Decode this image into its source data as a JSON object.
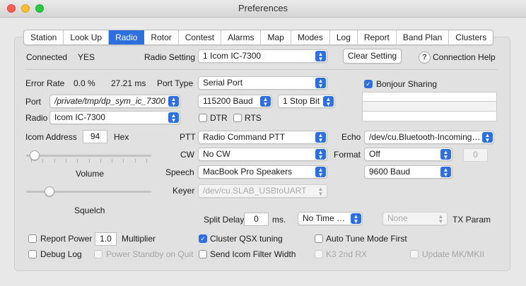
{
  "window": {
    "title": "Preferences"
  },
  "tabs": [
    {
      "label": "Station",
      "active": false
    },
    {
      "label": "Look Up",
      "active": false
    },
    {
      "label": "Radio",
      "active": true
    },
    {
      "label": "Rotor",
      "active": false
    },
    {
      "label": "Contest",
      "active": false
    },
    {
      "label": "Alarms",
      "active": false
    },
    {
      "label": "Map",
      "active": false
    },
    {
      "label": "Modes",
      "active": false
    },
    {
      "label": "Log",
      "active": false
    },
    {
      "label": "Report",
      "active": false
    },
    {
      "label": "Band Plan",
      "active": false
    },
    {
      "label": "Clusters",
      "active": false
    }
  ],
  "connection": {
    "status_label": "Connected",
    "status_value": "YES",
    "radio_setting_label": "Radio Setting",
    "radio_setting_value": "1 Icom IC-7300",
    "clear_setting_label": "Clear Setting",
    "help_label": "Connection Help"
  },
  "serial": {
    "error_rate_label": "Error Rate",
    "error_rate_value": "0.0 %",
    "latency_value": "27.21 ms",
    "port_type_label": "Port Type",
    "port_type_value": "Serial Port",
    "port_label": "Port",
    "port_value": "/private/tmp/dp_sym_ic_7300",
    "baud_value": "115200 Baud",
    "stop_bit_value": "1 Stop Bit",
    "radio_label": "Radio",
    "radio_value": "Icom IC-7300",
    "dtr_label": "DTR",
    "dtr_checked": false,
    "rts_label": "RTS",
    "rts_checked": false,
    "bonjour_label": "Bonjour Sharing",
    "bonjour_checked": true
  },
  "icom": {
    "address_label": "Icom Address",
    "address_value": "94",
    "hex_label": "Hex",
    "volume_label": "Volume",
    "volume_level": 0.03,
    "squelch_label": "Squelch",
    "squelch_level": 0.16
  },
  "audio": {
    "ptt_label": "PTT",
    "ptt_value": "Radio Command PTT",
    "cw_label": "CW",
    "cw_value": "No CW",
    "speech_label": "Speech",
    "speech_value": "MacBook Pro Speakers",
    "keyer_label": "Keyer",
    "keyer_value": "/dev/cu.SLAB_USBtoUART",
    "echo_label": "Echo",
    "echo_value": "/dev/cu.Bluetooth-Incoming-...",
    "format_label": "Format",
    "format_value": "Off",
    "format_number": "0",
    "echo_baud_value": "9600 Baud"
  },
  "timing": {
    "split_delay_label": "Split Delay",
    "split_delay_value": "0",
    "ms_label": "ms.",
    "time_set_value": "No Time Set",
    "tx_param_value": "None",
    "tx_param_label": "TX Param"
  },
  "options": {
    "report_power_label": "Report Power",
    "report_power_checked": false,
    "multiplier_value": "1.0",
    "multiplier_label": "Multiplier",
    "debug_log_label": "Debug Log",
    "debug_log_checked": false,
    "power_standby_label": "Power Standby on Quit",
    "power_standby_checked": false,
    "cluster_qsx_label": "Cluster QSX tuning",
    "cluster_qsx_checked": true,
    "send_filter_label": "Send Icom Filter Width",
    "send_filter_checked": false,
    "auto_tune_label": "Auto Tune Mode First",
    "auto_tune_checked": false,
    "k3_label": "K3 2nd RX",
    "k3_checked": false,
    "update_mk_label": "Update MK/MKII",
    "update_mk_checked": false
  }
}
